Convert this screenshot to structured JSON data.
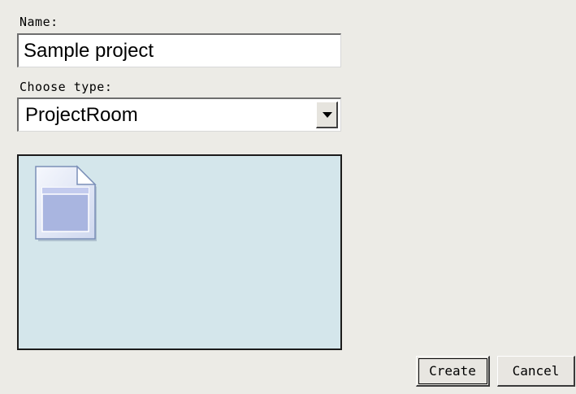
{
  "form": {
    "name_label": "Name:",
    "name_value": "Sample project",
    "type_label": "Choose type:",
    "type_selected": "ProjectRoom"
  },
  "preview": {
    "icon": "document-page-icon"
  },
  "buttons": {
    "create_label": "Create",
    "cancel_label": "Cancel"
  },
  "colors": {
    "background": "#ecebe6",
    "preview_background": "#d4e6eb",
    "icon_fill": "#e8edf8",
    "icon_window": "#a9b5e0"
  }
}
